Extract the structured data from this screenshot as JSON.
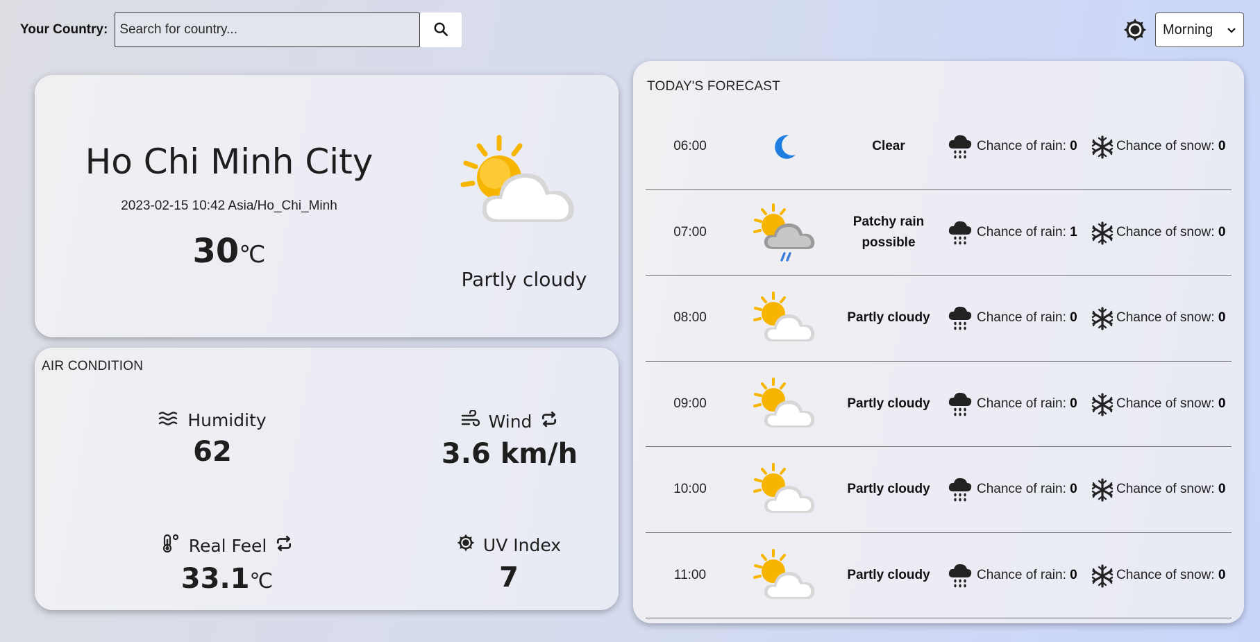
{
  "header": {
    "country_label": "Your Country:",
    "search_placeholder": "Search for country...",
    "time_of_day_selected": "Morning"
  },
  "current": {
    "city": "Ho Chi Minh City",
    "local_time": "2023-02-15 10:42 Asia/Ho_Chi_Minh",
    "temperature": "30",
    "temperature_unit": "℃",
    "condition": "Partly cloudy",
    "icon": "partly-cloudy-icon"
  },
  "air_condition": {
    "title": "AIR CONDITION",
    "humidity_label": "Humidity",
    "humidity_value": "62",
    "wind_label": "Wind",
    "wind_value": "3.6 km/h",
    "real_feel_label": "Real Feel",
    "real_feel_value": "33.1",
    "real_feel_unit": "℃",
    "uv_label": "UV Index",
    "uv_value": "7"
  },
  "forecast": {
    "title": "TODAY'S FORECAST",
    "rain_label": "Chance of rain:",
    "snow_label": "Chance of snow:",
    "rows": [
      {
        "time": "06:00",
        "icon": "moon-icon",
        "condition": "Clear",
        "rain": "0",
        "snow": "0"
      },
      {
        "time": "07:00",
        "icon": "patchy-rain-icon",
        "condition": "Patchy rain possible",
        "rain": "1",
        "snow": "0"
      },
      {
        "time": "08:00",
        "icon": "partly-cloudy-icon",
        "condition": "Partly cloudy",
        "rain": "0",
        "snow": "0"
      },
      {
        "time": "09:00",
        "icon": "partly-cloudy-icon",
        "condition": "Partly cloudy",
        "rain": "0",
        "snow": "0"
      },
      {
        "time": "10:00",
        "icon": "partly-cloudy-icon",
        "condition": "Partly cloudy",
        "rain": "0",
        "snow": "0"
      },
      {
        "time": "11:00",
        "icon": "partly-cloudy-icon",
        "condition": "Partly cloudy",
        "rain": "0",
        "snow": "0"
      }
    ]
  },
  "colors": {
    "sun": "#f7b500",
    "moon": "#1f7fe0",
    "rain_streak": "#3a7bd5"
  }
}
